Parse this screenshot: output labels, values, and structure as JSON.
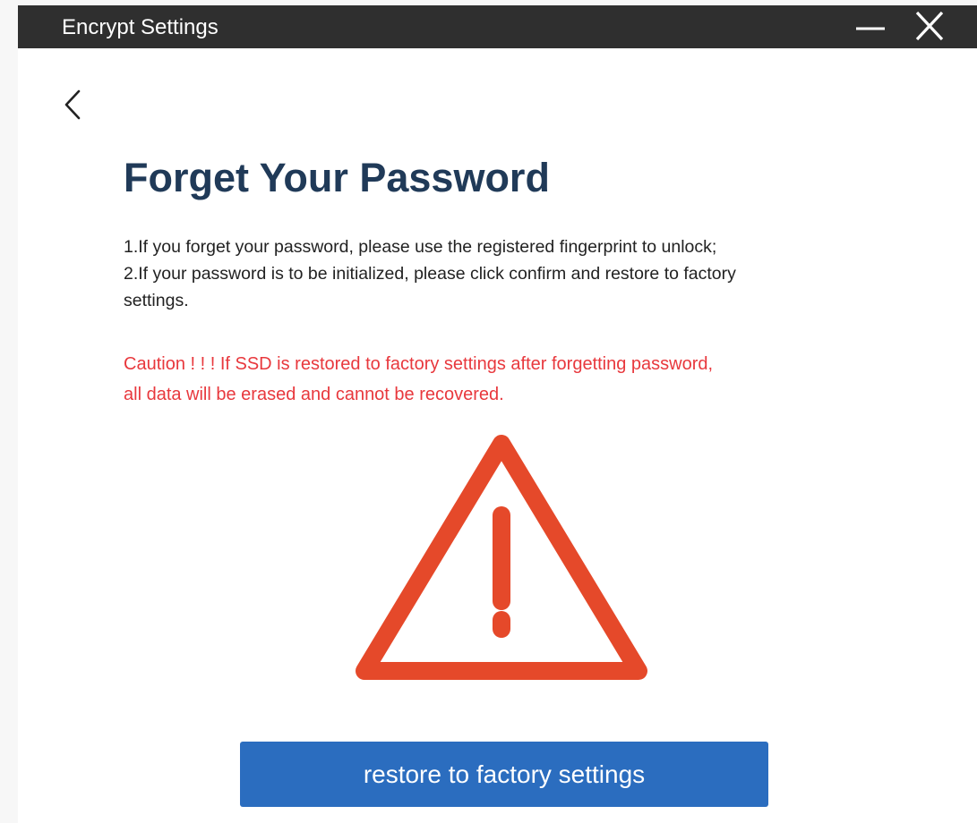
{
  "window": {
    "title": "Encrypt Settings",
    "controls": {
      "minimize_icon": "minimize-icon",
      "close_icon": "close-icon"
    }
  },
  "navigation": {
    "back_icon": "chevron-left-icon"
  },
  "main": {
    "heading": "Forget Your Password",
    "instructions": [
      "1.If you forget your password, please use the registered fingerprint to unlock;",
      "2.If your password is to be initialized, please click confirm and restore to factory",
      "settings."
    ],
    "caution": [
      "Caution ! ! !  If SSD is restored to factory settings after forgetting password,",
      "all data will be erased and cannot be recovered."
    ],
    "warning_icon": "warning-triangle-icon",
    "restore_button_label": "restore to factory settings"
  },
  "colors": {
    "titlebar": "#2f2f2f",
    "heading": "#203a58",
    "caution_text": "#e8383d",
    "warning_icon": "#e5492a",
    "button": "#2b6dbf"
  }
}
